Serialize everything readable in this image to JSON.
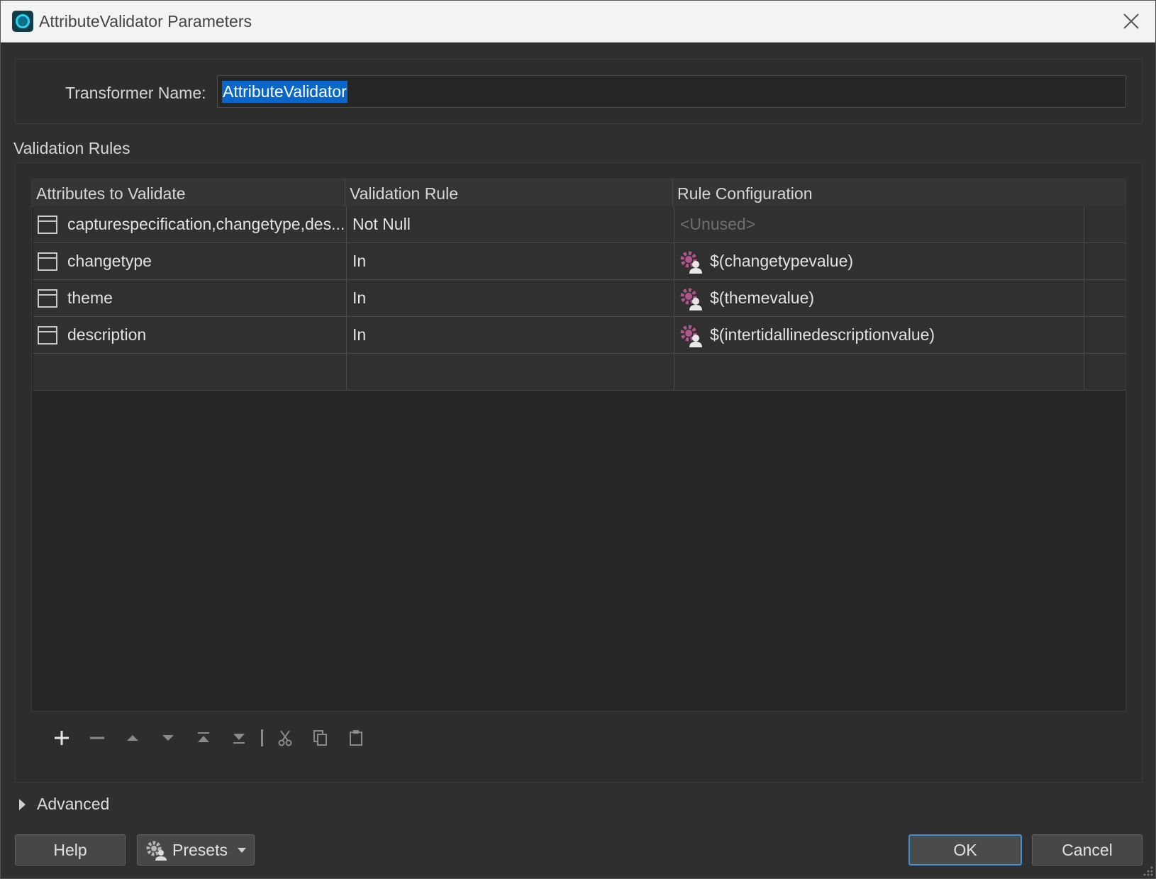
{
  "window": {
    "title": "AttributeValidator Parameters"
  },
  "name_panel": {
    "label": "Transformer Name:",
    "value": "AttributeValidator"
  },
  "section": {
    "label": "Validation Rules"
  },
  "table": {
    "headers": [
      "Attributes to Validate",
      "Validation Rule",
      "Rule Configuration"
    ],
    "rows": [
      {
        "attribute": "capturespecification,changetype,des...",
        "rule": "Not Null",
        "config": "<Unused>",
        "config_icon": "none"
      },
      {
        "attribute": "changetype",
        "rule": "In",
        "config": "$(changetypevalue)",
        "config_icon": "user-parameter-icon"
      },
      {
        "attribute": "theme",
        "rule": "In",
        "config": "$(themevalue)",
        "config_icon": "user-parameter-icon"
      },
      {
        "attribute": "description",
        "rule": "In",
        "config": "$(intertidallinedescriptionvalue)",
        "config_icon": "user-parameter-icon"
      }
    ]
  },
  "toolbar": {
    "icons": [
      "add-icon",
      "remove-icon",
      "move-up-icon",
      "move-down-icon",
      "move-top-icon",
      "move-bottom-icon",
      "cut-icon",
      "copy-icon",
      "paste-icon"
    ]
  },
  "advanced": {
    "label": "Advanced"
  },
  "buttons": {
    "help": "Help",
    "presets": "Presets",
    "ok": "OK",
    "cancel": "Cancel"
  },
  "colors": {
    "selection": "#0a67c9",
    "ok_border": "#3f8fd6",
    "param_icon": "#b0568d"
  }
}
